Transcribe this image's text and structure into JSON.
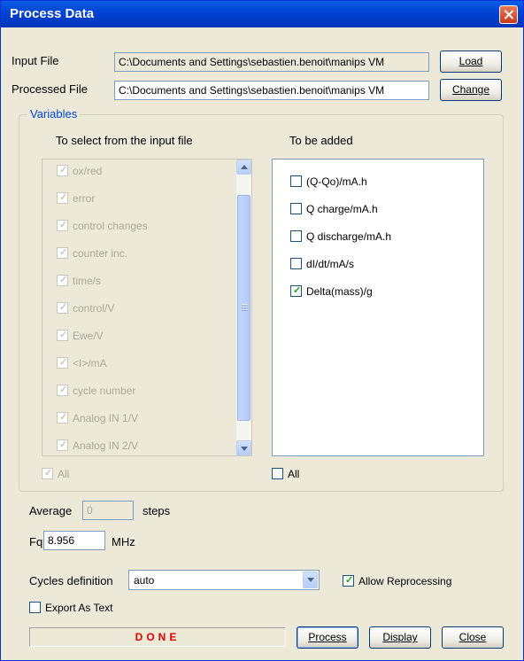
{
  "window": {
    "title": "Process Data"
  },
  "input_file": {
    "label": "Input File",
    "value": "C:\\Documents and Settings\\sebastien.benoit\\manips VM",
    "button": "Load"
  },
  "processed_file": {
    "label": "Processed File",
    "value": "C:\\Documents and Settings\\sebastien.benoit\\manips VM",
    "button": "Change"
  },
  "variables": {
    "group_label": "Variables",
    "left_header": "To select from the input file",
    "right_header": "To be added",
    "left_items": [
      {
        "label": "ox/red",
        "checked": true
      },
      {
        "label": "error",
        "checked": true
      },
      {
        "label": "control changes",
        "checked": true
      },
      {
        "label": "counter inc.",
        "checked": true
      },
      {
        "label": "time/s",
        "checked": true
      },
      {
        "label": "control/V",
        "checked": true
      },
      {
        "label": "Ewe/V",
        "checked": true
      },
      {
        "label": "<I>/mA",
        "checked": true
      },
      {
        "label": "cycle number",
        "checked": true
      },
      {
        "label": "Analog IN 1/V",
        "checked": true
      },
      {
        "label": "Analog IN 2/V",
        "checked": true
      }
    ],
    "right_items": [
      {
        "label": "(Q-Qo)/mA.h",
        "checked": false
      },
      {
        "label": "Q charge/mA.h",
        "checked": false
      },
      {
        "label": "Q discharge/mA.h",
        "checked": false
      },
      {
        "label": "dI/dt/mA/s",
        "checked": false
      },
      {
        "label": "Delta(mass)/g",
        "checked": true
      }
    ],
    "left_all": "All",
    "right_all": "All"
  },
  "average": {
    "label": "Average",
    "value": "0",
    "unit": "steps"
  },
  "fq": {
    "label": "Fq",
    "value": "8.956",
    "unit": "MHz"
  },
  "cycles": {
    "label": "Cycles definition",
    "value": "auto"
  },
  "allow_reprocessing": {
    "label": "Allow Reprocessing",
    "checked": true
  },
  "export_text": {
    "label": "Export As Text",
    "checked": false
  },
  "status": {
    "text": "DONE"
  },
  "buttons": {
    "process": "Process",
    "display": "Display",
    "close": "Close"
  },
  "colors": {
    "title_bar": "#0054e3",
    "status_text": "#e00000",
    "group_label": "#0046d5"
  }
}
